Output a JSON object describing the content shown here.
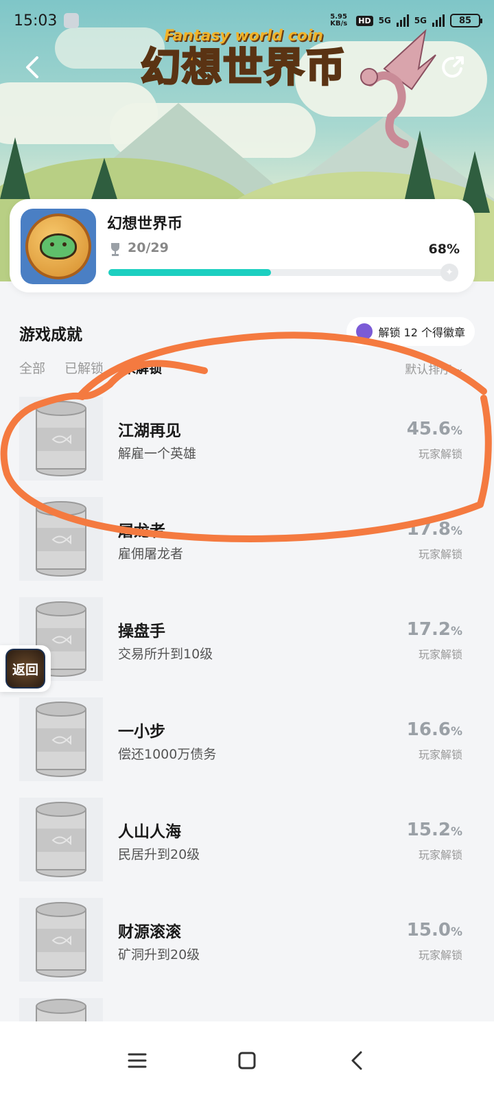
{
  "status_bar": {
    "time": "15:03",
    "net_speed": "5.95 KB/s",
    "hd": "HD",
    "signal1": "5G",
    "signal2": "5G",
    "battery": "85"
  },
  "banner": {
    "logo_en": "Fantasy world coin",
    "logo_cn": "幻想世界币"
  },
  "game": {
    "name": "幻想世界币",
    "progress_text": "20/29",
    "progress_percent": "68%",
    "progress_fraction": 0.68,
    "accent_color": "#1ccfc0"
  },
  "section": {
    "title": "游戏成就",
    "badge_text": "解锁 12 个得徽章"
  },
  "tabs": [
    "全部",
    "已解锁",
    "未解锁"
  ],
  "active_tab": "未解锁",
  "sort_label": "默认排序",
  "achievements": [
    {
      "name": "江湖再见",
      "desc": "解雇一个英雄",
      "pct": "45.6",
      "pct_unit": "%",
      "label": "玩家解锁"
    },
    {
      "name": "屠龙者",
      "desc": "雇佣屠龙者",
      "pct": "17.8",
      "pct_unit": "%",
      "label": "玩家解锁"
    },
    {
      "name": "操盘手",
      "desc": "交易所升到10级",
      "pct": "17.2",
      "pct_unit": "%",
      "label": "玩家解锁"
    },
    {
      "name": "一小步",
      "desc": "偿还1000万债务",
      "pct": "16.6",
      "pct_unit": "%",
      "label": "玩家解锁"
    },
    {
      "name": "人山人海",
      "desc": "民居升到20级",
      "pct": "15.2",
      "pct_unit": "%",
      "label": "玩家解锁"
    },
    {
      "name": "财源滚滚",
      "desc": "矿洞升到20级",
      "pct": "15.0",
      "pct_unit": "%",
      "label": "玩家解锁"
    }
  ],
  "float_button": "返回",
  "annotation_color": "#f47a40",
  "icons": {
    "back": "back-arrow-icon",
    "share": "share-icon",
    "trophy": "trophy-icon",
    "badge": "badge-icon",
    "sort": "chevron-down-icon",
    "nav_menu": "menu-icon",
    "nav_home": "home-square-icon",
    "nav_back": "nav-back-icon"
  }
}
